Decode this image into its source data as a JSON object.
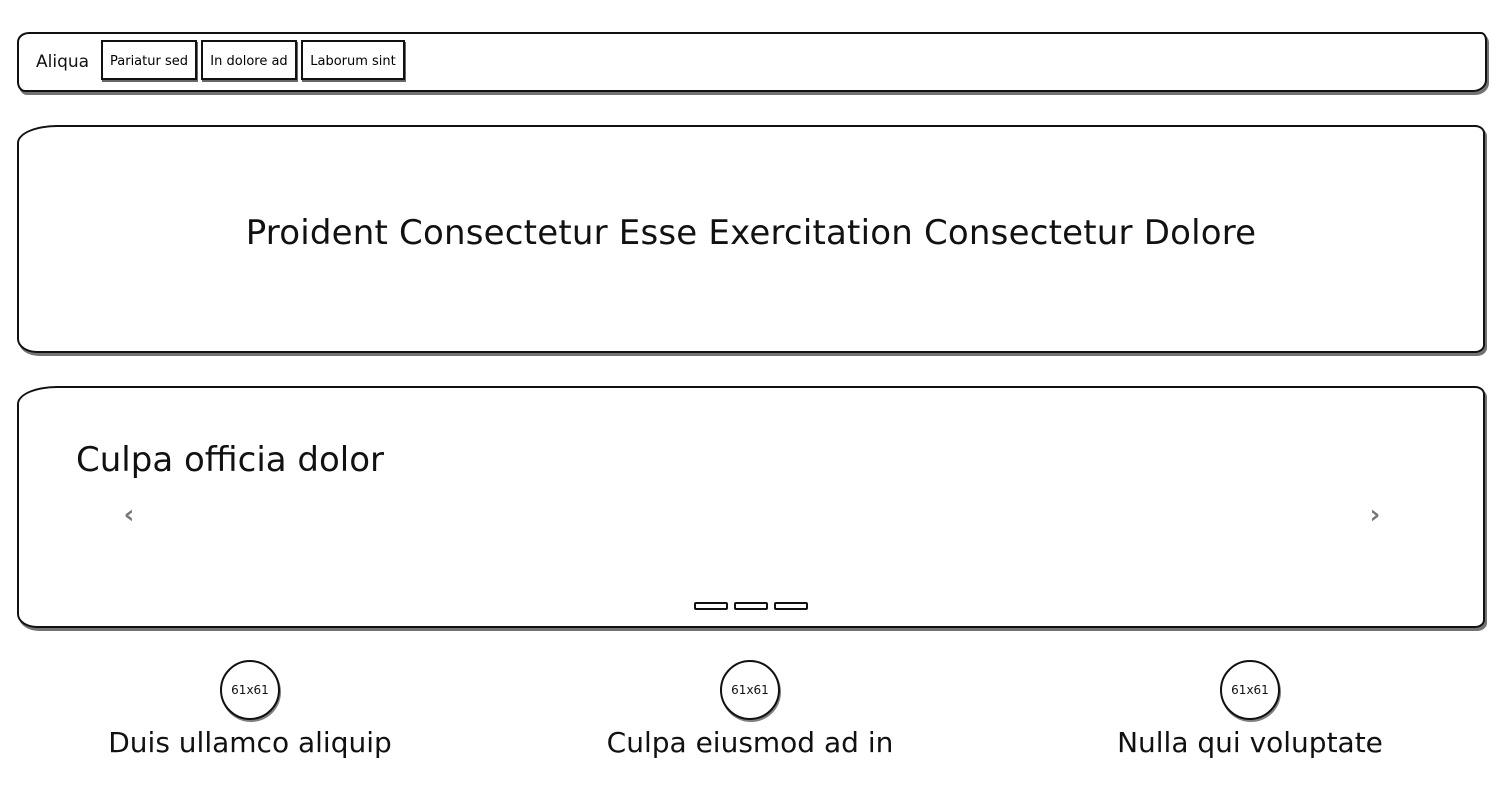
{
  "navbar": {
    "brand": "Aliqua",
    "buttons": [
      {
        "label": "Pariatur sed"
      },
      {
        "label": "In dolore ad"
      },
      {
        "label": "Laborum sint"
      }
    ]
  },
  "hero": {
    "title": "Proident Consectetur Esse Exercitation Consectetur Dolore"
  },
  "carousel": {
    "caption": "Culpa officia dolor",
    "prev_icon": "‹",
    "next_icon": "›",
    "indicator_count": 3
  },
  "features": [
    {
      "image_label": "61x61",
      "title": "Duis ullamco aliquip"
    },
    {
      "image_label": "61x61",
      "title": "Culpa eiusmod ad in"
    },
    {
      "image_label": "61x61",
      "title": "Nulla qui voluptate"
    }
  ]
}
